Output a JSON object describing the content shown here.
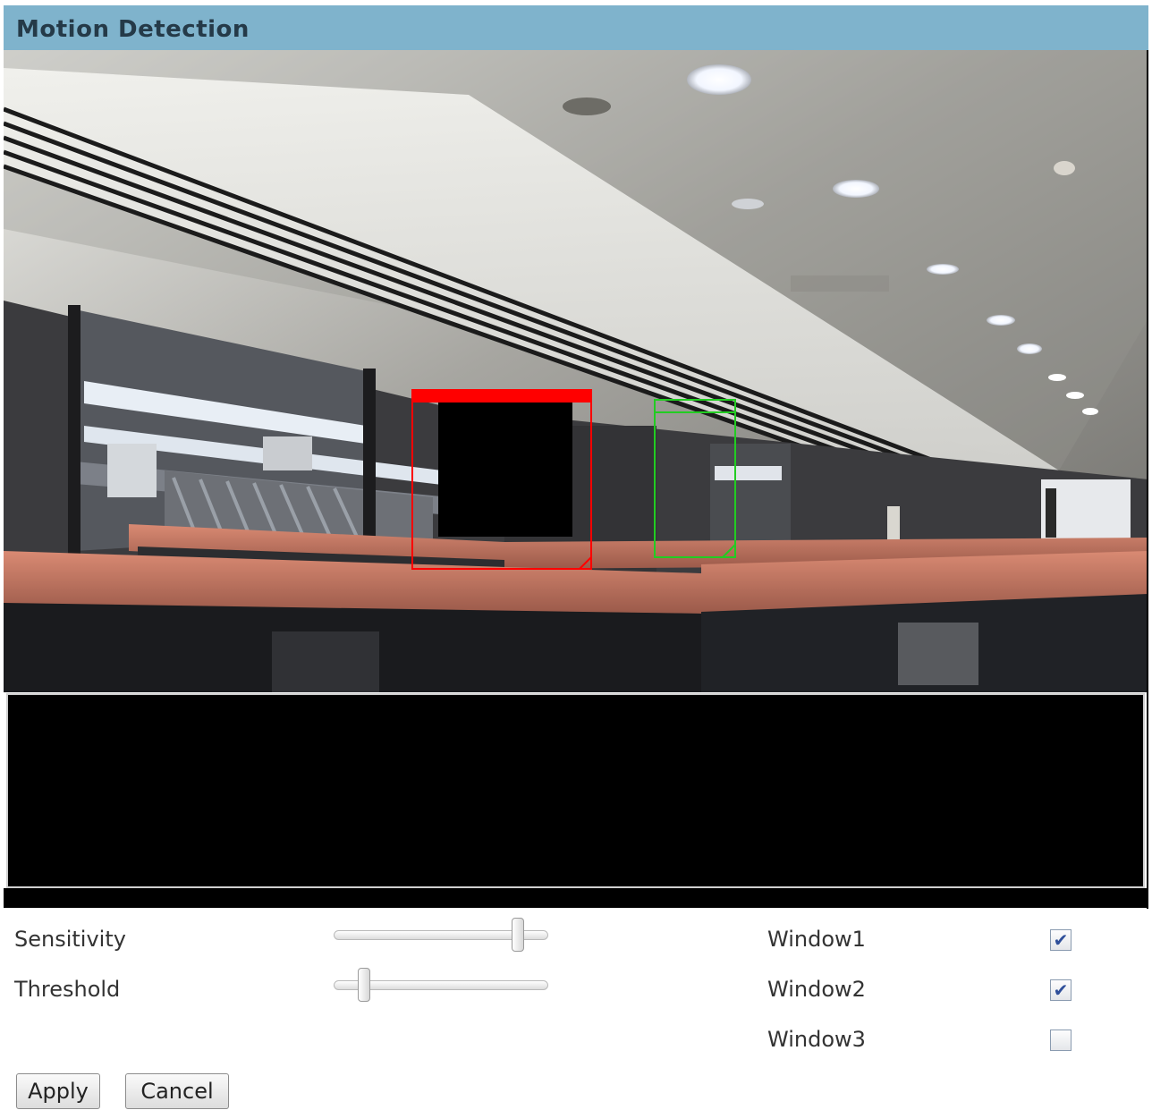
{
  "header": {
    "title": "Motion Detection"
  },
  "controls": {
    "sensitivity": {
      "label": "Sensitivity",
      "level": 0.88
    },
    "threshold": {
      "label": "Threshold",
      "level": 0.12
    }
  },
  "windows": [
    {
      "label": "Window1",
      "checked": true
    },
    {
      "label": "Window2",
      "checked": true
    },
    {
      "label": "Window3",
      "checked": false
    }
  ],
  "buttons": {
    "apply": "Apply",
    "cancel": "Cancel"
  },
  "colors": {
    "header_bg": "#7fb3cc",
    "window1_box": "#ff0000",
    "window2_box": "#22cc22"
  },
  "icons": {
    "checkbox_checked": "checkmark-icon"
  }
}
